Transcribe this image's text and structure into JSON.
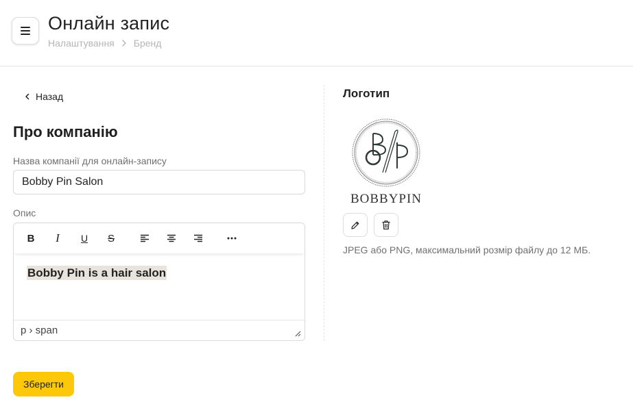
{
  "header": {
    "title": "Онлайн запис",
    "breadcrumb": [
      "Налаштування",
      "Бренд"
    ]
  },
  "back_link": "Назад",
  "company": {
    "section_title": "Про компанію",
    "name_label": "Назва компанії для онлайн-запису",
    "name_value": "Bobby Pin Salon",
    "description_label": "Опис",
    "toolbar": {
      "bold": "B",
      "italic": "I",
      "underline": "U",
      "strike": "S"
    },
    "description_value": "Bobby Pin is a hair salon",
    "statusbar_path": "p › span"
  },
  "logo": {
    "title": "Логотип",
    "logo_text": "BOBBYPIN",
    "hint": "JPEG або PNG, максимальний розмір файлу до 12 МБ."
  },
  "save_label": "Зберегти",
  "colors": {
    "accent": "#fdc80a",
    "text": "#1f1f1f",
    "muted": "#707070",
    "breadcrumb": "#b5b5b5",
    "border": "#d9d9d9"
  },
  "icons": [
    "menu-icon",
    "chevron-right-icon",
    "chevron-left-icon",
    "align-left-icon",
    "align-center-icon",
    "align-right-icon",
    "more-icon",
    "resize-icon",
    "pencil-icon",
    "trash-icon"
  ]
}
